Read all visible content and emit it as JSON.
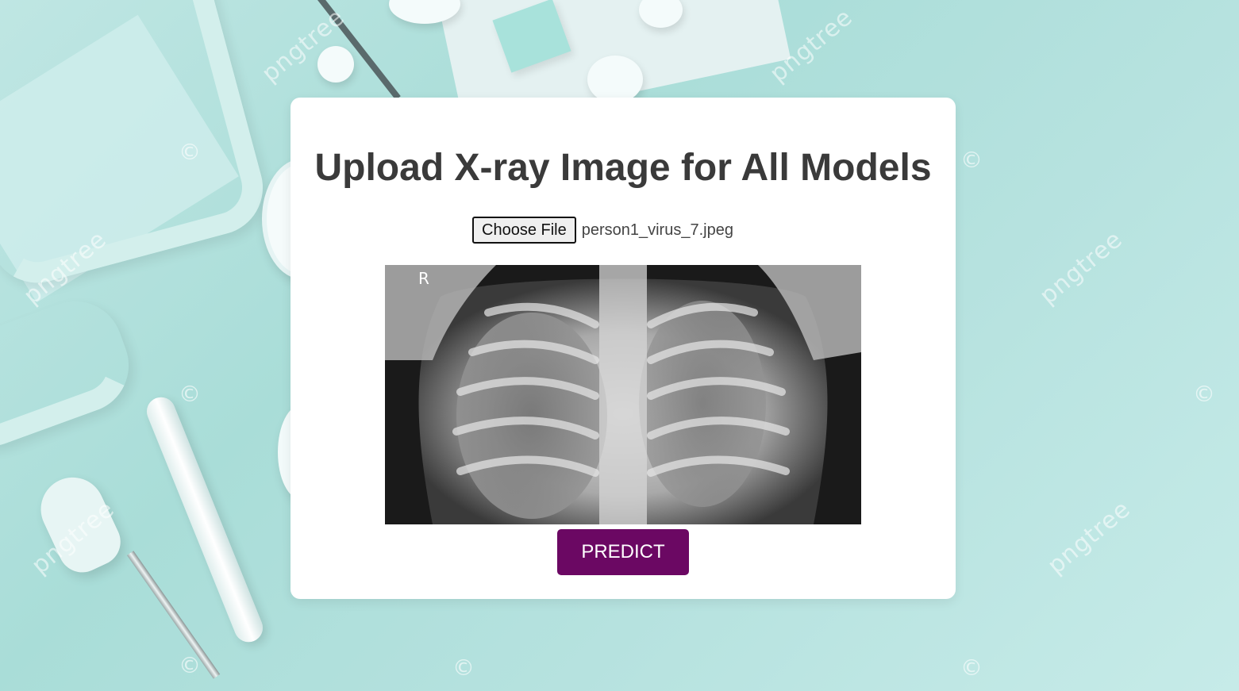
{
  "page": {
    "title": "Upload X-ray Image for All Models"
  },
  "upload": {
    "choose_label": "Choose File",
    "file_name": "person1_virus_7.jpeg"
  },
  "preview": {
    "marker": "R"
  },
  "actions": {
    "predict_label": "PREDICT"
  },
  "background": {
    "watermark_text": "pngtree",
    "copyright_glyph": "©"
  },
  "colors": {
    "accent": "#6b0863",
    "background": "#b6e2df",
    "card": "#ffffff",
    "title": "#3a3a3a"
  }
}
